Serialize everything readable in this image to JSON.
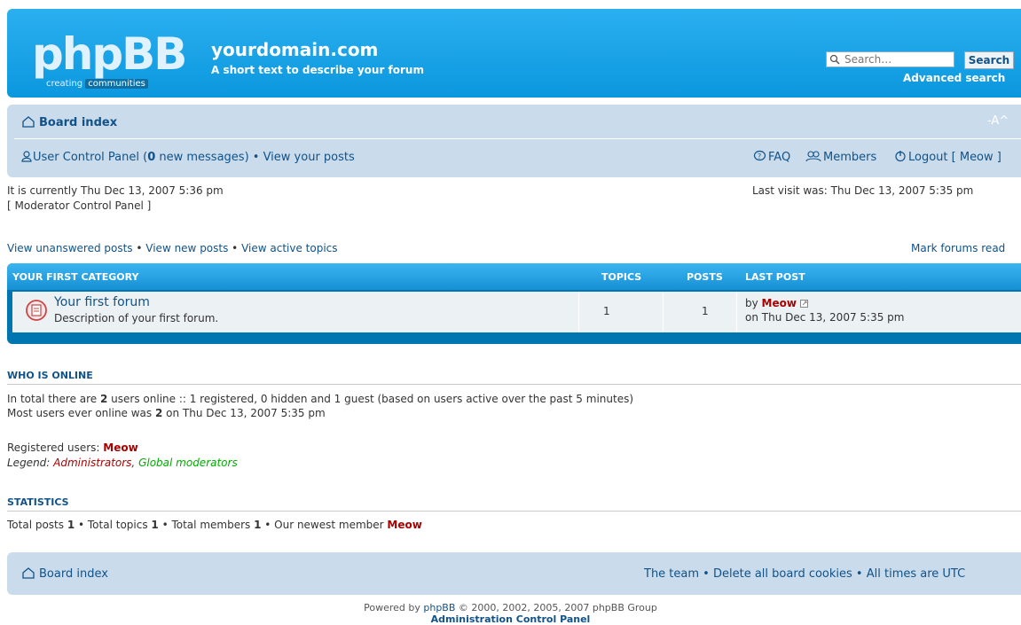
{
  "header": {
    "logo_text": "phpBB",
    "logo_sub_1": "creating",
    "logo_sub_2": "communities",
    "site_title": "yourdomain.com",
    "site_desc": "A short text to describe your forum",
    "search_placeholder": "Search…",
    "search_button": "Search",
    "advanced_search": "Advanced search"
  },
  "navbar": {
    "board_index": "Board index",
    "font_size": "-A^",
    "ucp": "User Control Panel",
    "ucp_open": " (",
    "new_count": "0",
    "new_messages": " new messages)",
    "sep": " • ",
    "view_posts": "View your posts",
    "faq": "FAQ",
    "members": "Members",
    "logout": "Logout [ Meow ]"
  },
  "status": {
    "current_time": "It is currently Thu Dec 13, 2007 5:36 pm",
    "mcp": "[ Moderator Control Panel ]",
    "last_visit": "Last visit was: Thu Dec 13, 2007 5:35 pm"
  },
  "links": {
    "unanswered": "View unanswered posts",
    "sep": " • ",
    "new_posts": "View new posts",
    "active": "View active topics",
    "mark_read": "Mark forums read"
  },
  "forum_table": {
    "category": "YOUR FIRST CATEGORY",
    "col_topics": "TOPICS",
    "col_posts": "POSTS",
    "col_last": "LAST POST",
    "forum_name": "Your first forum",
    "forum_desc": "Description of your first forum.",
    "topics": "1",
    "posts": "1",
    "last_by": "by ",
    "last_user": "Meow",
    "last_on": "on Thu Dec 13, 2007 5:35 pm"
  },
  "online": {
    "title": "WHO IS ONLINE",
    "line1_a": "In total there are ",
    "line1_count": "2",
    "line1_b": " users online :: 1 registered, 0 hidden and 1 guest (based on users active over the past 5 minutes)",
    "line2_a": "Most users ever online was ",
    "line2_count": "2",
    "line2_b": " on Thu Dec 13, 2007 5:35 pm",
    "registered_label": "Registered users: ",
    "registered_user": "Meow",
    "legend_label": "Legend: ",
    "legend_admin": "Administrators",
    "legend_comma": ", ",
    "legend_gmod": "Global moderators"
  },
  "stats": {
    "title": "STATISTICS",
    "posts_label": "Total posts ",
    "posts": "1",
    "topics_label": " • Total topics ",
    "topics": "1",
    "members_label": " • Total members ",
    "members": "1",
    "newest_label": " • Our newest member ",
    "newest": "Meow"
  },
  "footer": {
    "board_index": "Board index",
    "team": "The team",
    "sep": " • ",
    "delete_cookies": "Delete all board cookies",
    "times": "All times are UTC",
    "powered_by": "Powered by ",
    "phpbb": "phpBB",
    "copyright": " © 2000, 2002, 2005, 2007 phpBB Group",
    "acp": "Administration Control Panel"
  },
  "colors": {
    "header_blue": "#12a3eb",
    "nav_bg": "#cadceb",
    "link": "#105289",
    "user_red": "#aa0000",
    "gmod_green": "#00aa00"
  }
}
